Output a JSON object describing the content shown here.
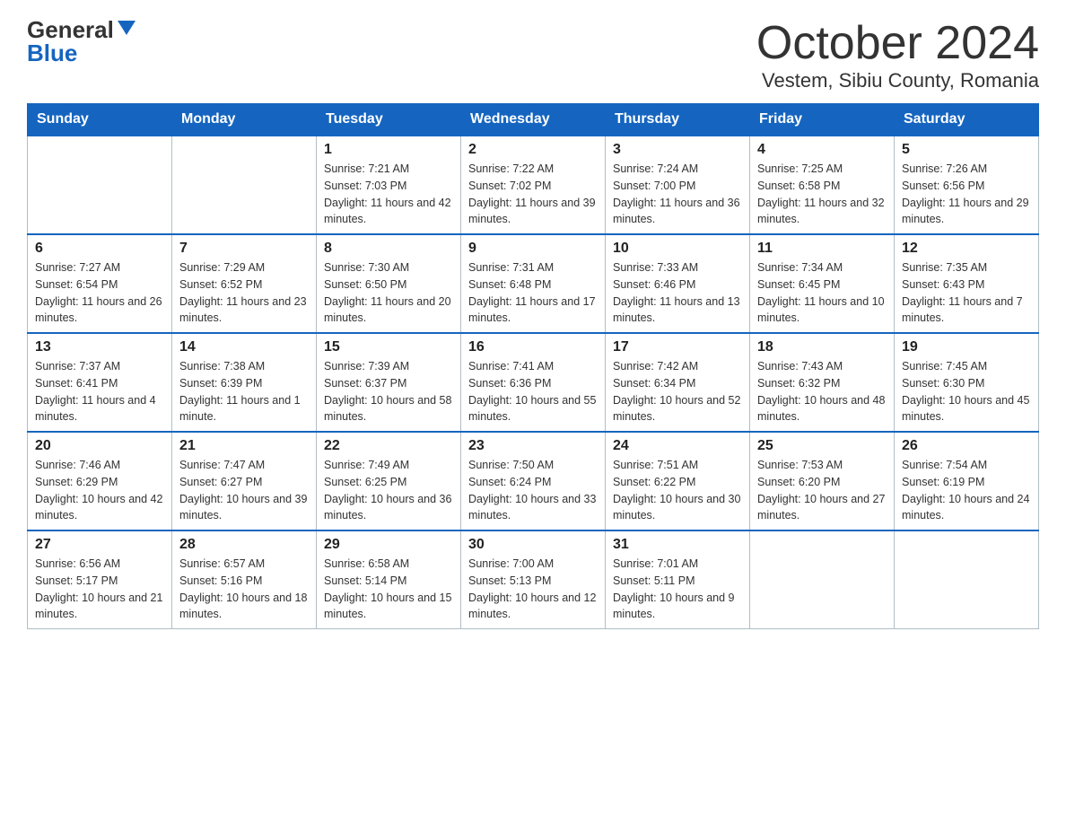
{
  "header": {
    "logo_general": "General",
    "logo_blue": "Blue",
    "month_title": "October 2024",
    "location": "Vestem, Sibiu County, Romania"
  },
  "calendar": {
    "days_of_week": [
      "Sunday",
      "Monday",
      "Tuesday",
      "Wednesday",
      "Thursday",
      "Friday",
      "Saturday"
    ],
    "weeks": [
      [
        {
          "day": "",
          "sunrise": "",
          "sunset": "",
          "daylight": ""
        },
        {
          "day": "",
          "sunrise": "",
          "sunset": "",
          "daylight": ""
        },
        {
          "day": "1",
          "sunrise": "Sunrise: 7:21 AM",
          "sunset": "Sunset: 7:03 PM",
          "daylight": "Daylight: 11 hours and 42 minutes."
        },
        {
          "day": "2",
          "sunrise": "Sunrise: 7:22 AM",
          "sunset": "Sunset: 7:02 PM",
          "daylight": "Daylight: 11 hours and 39 minutes."
        },
        {
          "day": "3",
          "sunrise": "Sunrise: 7:24 AM",
          "sunset": "Sunset: 7:00 PM",
          "daylight": "Daylight: 11 hours and 36 minutes."
        },
        {
          "day": "4",
          "sunrise": "Sunrise: 7:25 AM",
          "sunset": "Sunset: 6:58 PM",
          "daylight": "Daylight: 11 hours and 32 minutes."
        },
        {
          "day": "5",
          "sunrise": "Sunrise: 7:26 AM",
          "sunset": "Sunset: 6:56 PM",
          "daylight": "Daylight: 11 hours and 29 minutes."
        }
      ],
      [
        {
          "day": "6",
          "sunrise": "Sunrise: 7:27 AM",
          "sunset": "Sunset: 6:54 PM",
          "daylight": "Daylight: 11 hours and 26 minutes."
        },
        {
          "day": "7",
          "sunrise": "Sunrise: 7:29 AM",
          "sunset": "Sunset: 6:52 PM",
          "daylight": "Daylight: 11 hours and 23 minutes."
        },
        {
          "day": "8",
          "sunrise": "Sunrise: 7:30 AM",
          "sunset": "Sunset: 6:50 PM",
          "daylight": "Daylight: 11 hours and 20 minutes."
        },
        {
          "day": "9",
          "sunrise": "Sunrise: 7:31 AM",
          "sunset": "Sunset: 6:48 PM",
          "daylight": "Daylight: 11 hours and 17 minutes."
        },
        {
          "day": "10",
          "sunrise": "Sunrise: 7:33 AM",
          "sunset": "Sunset: 6:46 PM",
          "daylight": "Daylight: 11 hours and 13 minutes."
        },
        {
          "day": "11",
          "sunrise": "Sunrise: 7:34 AM",
          "sunset": "Sunset: 6:45 PM",
          "daylight": "Daylight: 11 hours and 10 minutes."
        },
        {
          "day": "12",
          "sunrise": "Sunrise: 7:35 AM",
          "sunset": "Sunset: 6:43 PM",
          "daylight": "Daylight: 11 hours and 7 minutes."
        }
      ],
      [
        {
          "day": "13",
          "sunrise": "Sunrise: 7:37 AM",
          "sunset": "Sunset: 6:41 PM",
          "daylight": "Daylight: 11 hours and 4 minutes."
        },
        {
          "day": "14",
          "sunrise": "Sunrise: 7:38 AM",
          "sunset": "Sunset: 6:39 PM",
          "daylight": "Daylight: 11 hours and 1 minute."
        },
        {
          "day": "15",
          "sunrise": "Sunrise: 7:39 AM",
          "sunset": "Sunset: 6:37 PM",
          "daylight": "Daylight: 10 hours and 58 minutes."
        },
        {
          "day": "16",
          "sunrise": "Sunrise: 7:41 AM",
          "sunset": "Sunset: 6:36 PM",
          "daylight": "Daylight: 10 hours and 55 minutes."
        },
        {
          "day": "17",
          "sunrise": "Sunrise: 7:42 AM",
          "sunset": "Sunset: 6:34 PM",
          "daylight": "Daylight: 10 hours and 52 minutes."
        },
        {
          "day": "18",
          "sunrise": "Sunrise: 7:43 AM",
          "sunset": "Sunset: 6:32 PM",
          "daylight": "Daylight: 10 hours and 48 minutes."
        },
        {
          "day": "19",
          "sunrise": "Sunrise: 7:45 AM",
          "sunset": "Sunset: 6:30 PM",
          "daylight": "Daylight: 10 hours and 45 minutes."
        }
      ],
      [
        {
          "day": "20",
          "sunrise": "Sunrise: 7:46 AM",
          "sunset": "Sunset: 6:29 PM",
          "daylight": "Daylight: 10 hours and 42 minutes."
        },
        {
          "day": "21",
          "sunrise": "Sunrise: 7:47 AM",
          "sunset": "Sunset: 6:27 PM",
          "daylight": "Daylight: 10 hours and 39 minutes."
        },
        {
          "day": "22",
          "sunrise": "Sunrise: 7:49 AM",
          "sunset": "Sunset: 6:25 PM",
          "daylight": "Daylight: 10 hours and 36 minutes."
        },
        {
          "day": "23",
          "sunrise": "Sunrise: 7:50 AM",
          "sunset": "Sunset: 6:24 PM",
          "daylight": "Daylight: 10 hours and 33 minutes."
        },
        {
          "day": "24",
          "sunrise": "Sunrise: 7:51 AM",
          "sunset": "Sunset: 6:22 PM",
          "daylight": "Daylight: 10 hours and 30 minutes."
        },
        {
          "day": "25",
          "sunrise": "Sunrise: 7:53 AM",
          "sunset": "Sunset: 6:20 PM",
          "daylight": "Daylight: 10 hours and 27 minutes."
        },
        {
          "day": "26",
          "sunrise": "Sunrise: 7:54 AM",
          "sunset": "Sunset: 6:19 PM",
          "daylight": "Daylight: 10 hours and 24 minutes."
        }
      ],
      [
        {
          "day": "27",
          "sunrise": "Sunrise: 6:56 AM",
          "sunset": "Sunset: 5:17 PM",
          "daylight": "Daylight: 10 hours and 21 minutes."
        },
        {
          "day": "28",
          "sunrise": "Sunrise: 6:57 AM",
          "sunset": "Sunset: 5:16 PM",
          "daylight": "Daylight: 10 hours and 18 minutes."
        },
        {
          "day": "29",
          "sunrise": "Sunrise: 6:58 AM",
          "sunset": "Sunset: 5:14 PM",
          "daylight": "Daylight: 10 hours and 15 minutes."
        },
        {
          "day": "30",
          "sunrise": "Sunrise: 7:00 AM",
          "sunset": "Sunset: 5:13 PM",
          "daylight": "Daylight: 10 hours and 12 minutes."
        },
        {
          "day": "31",
          "sunrise": "Sunrise: 7:01 AM",
          "sunset": "Sunset: 5:11 PM",
          "daylight": "Daylight: 10 hours and 9 minutes."
        },
        {
          "day": "",
          "sunrise": "",
          "sunset": "",
          "daylight": ""
        },
        {
          "day": "",
          "sunrise": "",
          "sunset": "",
          "daylight": ""
        }
      ]
    ]
  }
}
